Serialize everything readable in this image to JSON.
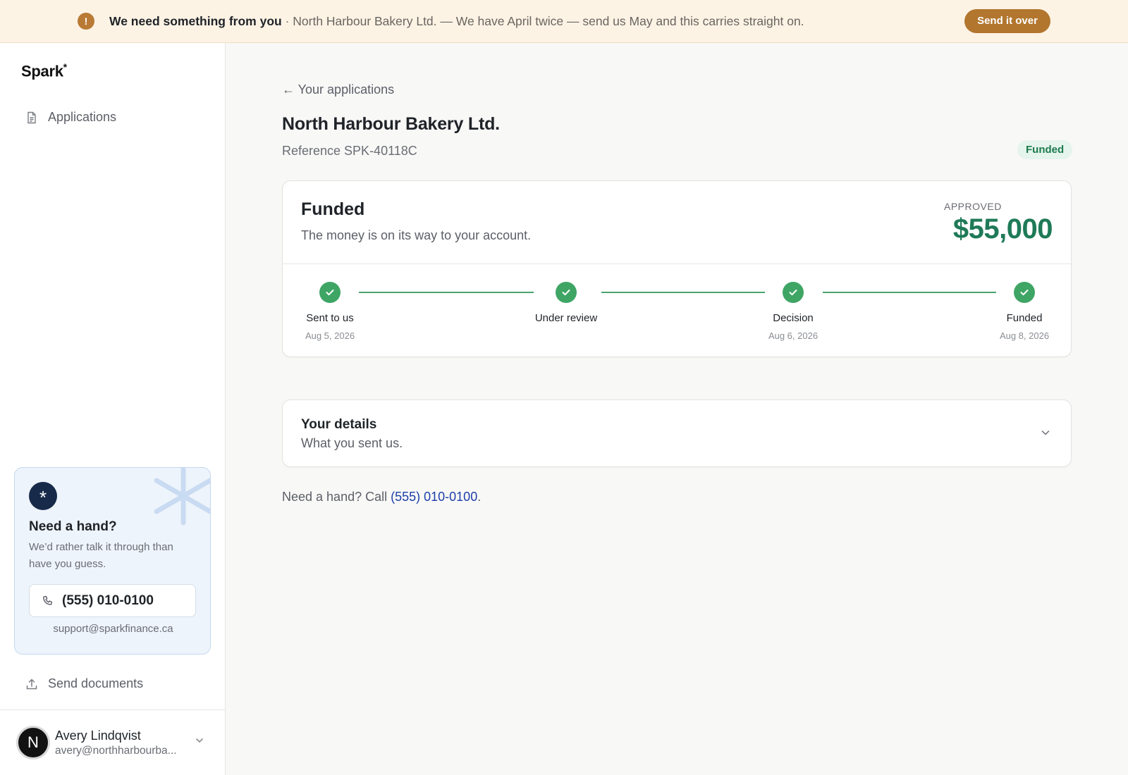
{
  "banner": {
    "icon": "exclamation-icon",
    "icon_glyph": "!",
    "heading": "We need something from you",
    "separator": " · ",
    "message": "North Harbour Bakery Ltd. — We have April twice — send us May and this carries straight on.",
    "action_label": "Send it over",
    "accent_color": "#b2762f"
  },
  "sidebar": {
    "logo": "Spark",
    "logo_mark": "*",
    "nav": [
      {
        "label": "Applications",
        "icon": "document-icon"
      }
    ],
    "help_card": {
      "icon": "asterisk-icon",
      "icon_glyph": "*",
      "title": "Need a hand?",
      "body": "We’d rather talk it through than have you guess.",
      "phone": "(555) 010-0100",
      "email": "support@sparkfinance.ca"
    },
    "send_documents": {
      "label": "Send documents",
      "icon": "upload-icon"
    },
    "user": {
      "initial": "N",
      "name": "Avery Lindqvist",
      "email": "avery@northharbourba..."
    }
  },
  "main": {
    "back_label": "← Your applications",
    "title": "North Harbour Bakery Ltd.",
    "reference": "Reference SPK-40118C",
    "status_badge": "Funded",
    "status_card": {
      "title": "Funded",
      "subtitle": "The money is on its way to your account.",
      "approved_label": "APPROVED",
      "amount": "$55,000",
      "amount_color": "#1f7a57",
      "steps": [
        {
          "label": "Sent to us",
          "date": "Aug 5, 2026",
          "done": true
        },
        {
          "label": "Under review",
          "date": "",
          "done": true
        },
        {
          "label": "Decision",
          "date": "Aug 6, 2026",
          "done": true
        },
        {
          "label": "Funded",
          "date": "Aug 8, 2026",
          "done": true
        }
      ]
    },
    "details_card": {
      "title": "Your details",
      "subtitle": "What you sent us."
    },
    "help_line": {
      "prefix": "Need a hand? Call ",
      "phone": "(555) 010-0100",
      "suffix": "."
    }
  },
  "colors": {
    "success": "#3fa565",
    "link": "#1d3fa8",
    "badge_bg": "#e5f4ec"
  }
}
